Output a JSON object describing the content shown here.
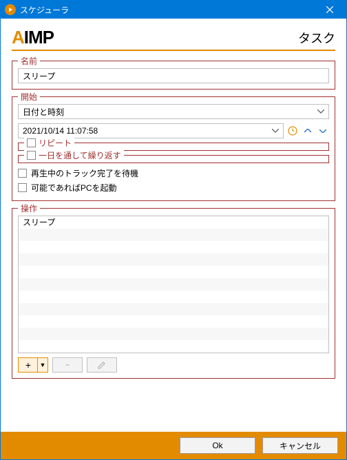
{
  "window": {
    "title": "スケジューラ"
  },
  "header": {
    "logo_text": "AIMP",
    "page_title": "タスク"
  },
  "groups": {
    "name": {
      "legend": "名前",
      "value": "スリープ"
    },
    "start": {
      "legend": "開始",
      "mode_select": "日付と時刻",
      "datetime": "2021/10/14 11:07:58",
      "repeat": {
        "legend": "リピート",
        "checked": false
      },
      "all_day": {
        "legend": "一日を通して繰り返す",
        "checked": false
      },
      "wait_track": {
        "label": "再生中のトラック完了を待機",
        "checked": false
      },
      "wake_pc": {
        "label": "可能であればPCを起動",
        "checked": false
      }
    },
    "actions": {
      "legend": "操作",
      "items": [
        "スリープ"
      ]
    }
  },
  "buttons": {
    "ok": "Ok",
    "cancel": "キャンセル"
  }
}
